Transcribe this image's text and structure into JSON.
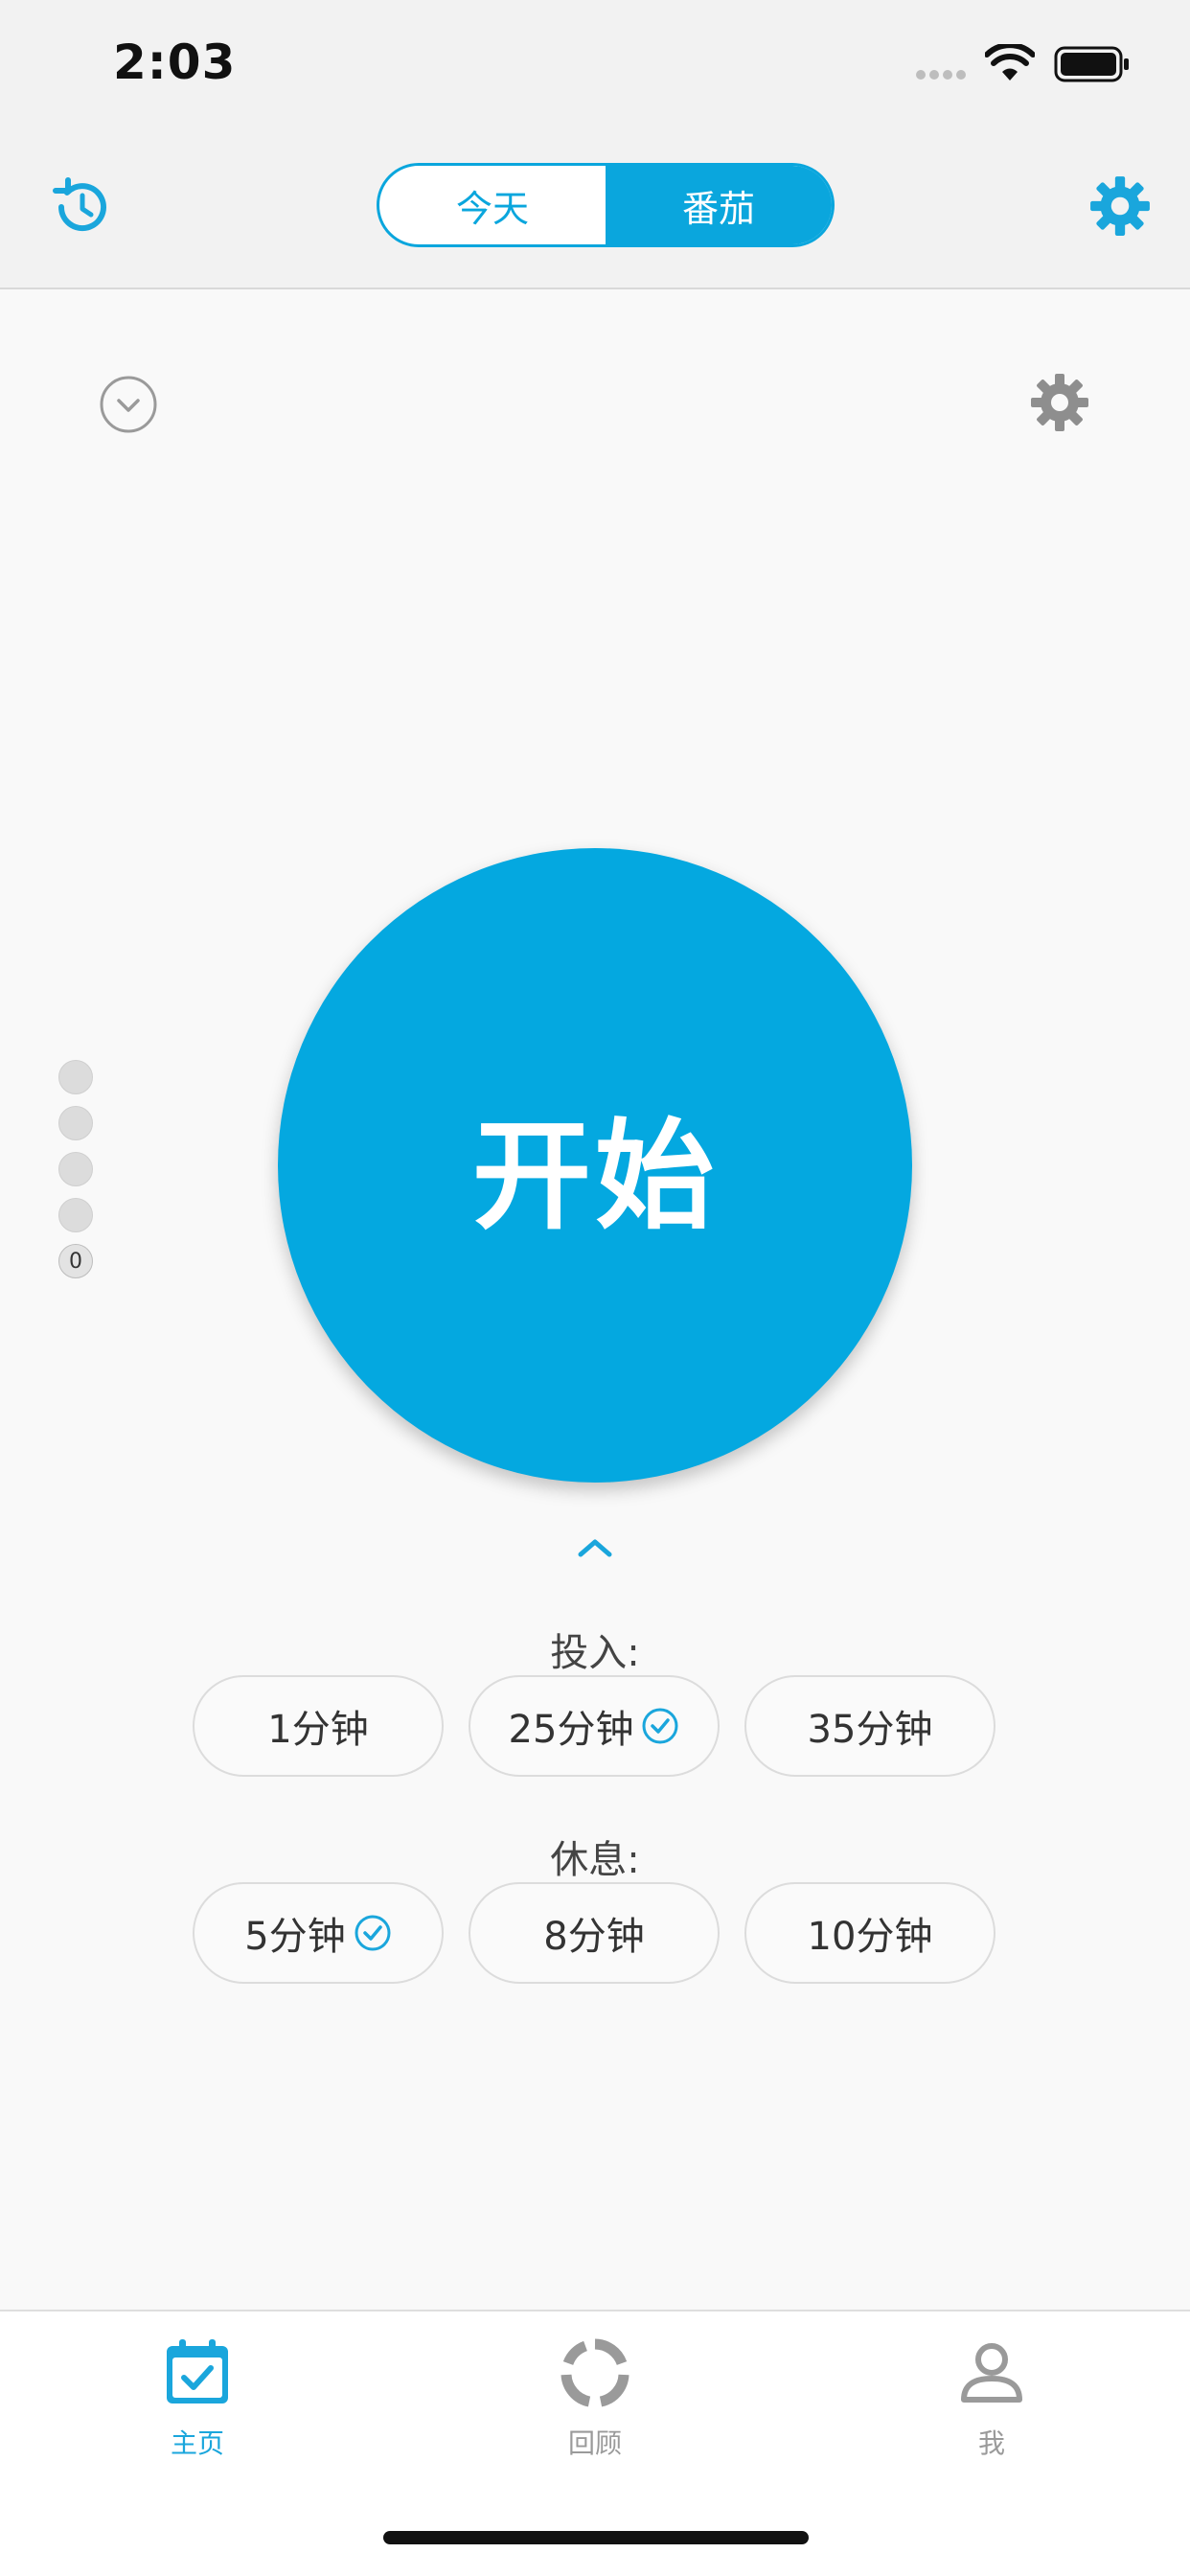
{
  "status_bar": {
    "time": "2:03",
    "icons": [
      "cellular-dots-icon",
      "wifi-icon",
      "battery-icon"
    ]
  },
  "nav": {
    "left_icon": "history-icon",
    "right_icon": "gear-icon",
    "segments": [
      {
        "label": "今天",
        "active": false
      },
      {
        "label": "番茄",
        "active": true
      }
    ]
  },
  "content": {
    "collapse_icon": "chevron-down-circle-icon",
    "settings_icon": "gear-icon",
    "progress_dots": {
      "count_label": "0"
    },
    "start_button": {
      "label": "开始"
    },
    "expand_icon": "chevron-up-icon",
    "focus": {
      "label": "投入:",
      "options": [
        {
          "label": "1分钟",
          "selected": false
        },
        {
          "label": "25分钟",
          "selected": true
        },
        {
          "label": "35分钟",
          "selected": false
        }
      ]
    },
    "rest": {
      "label": "休息:",
      "options": [
        {
          "label": "5分钟",
          "selected": true
        },
        {
          "label": "8分钟",
          "selected": false
        },
        {
          "label": "10分钟",
          "selected": false
        }
      ]
    }
  },
  "tabbar": {
    "items": [
      {
        "label": "主页",
        "icon": "calendar-check-icon",
        "active": true
      },
      {
        "label": "回顾",
        "icon": "ring-chart-icon",
        "active": false
      },
      {
        "label": "我",
        "icon": "person-icon",
        "active": false
      }
    ]
  },
  "colors": {
    "accent": "#04a8e0",
    "inactive": "#9a9a9a",
    "background": "#f9f9f9"
  }
}
